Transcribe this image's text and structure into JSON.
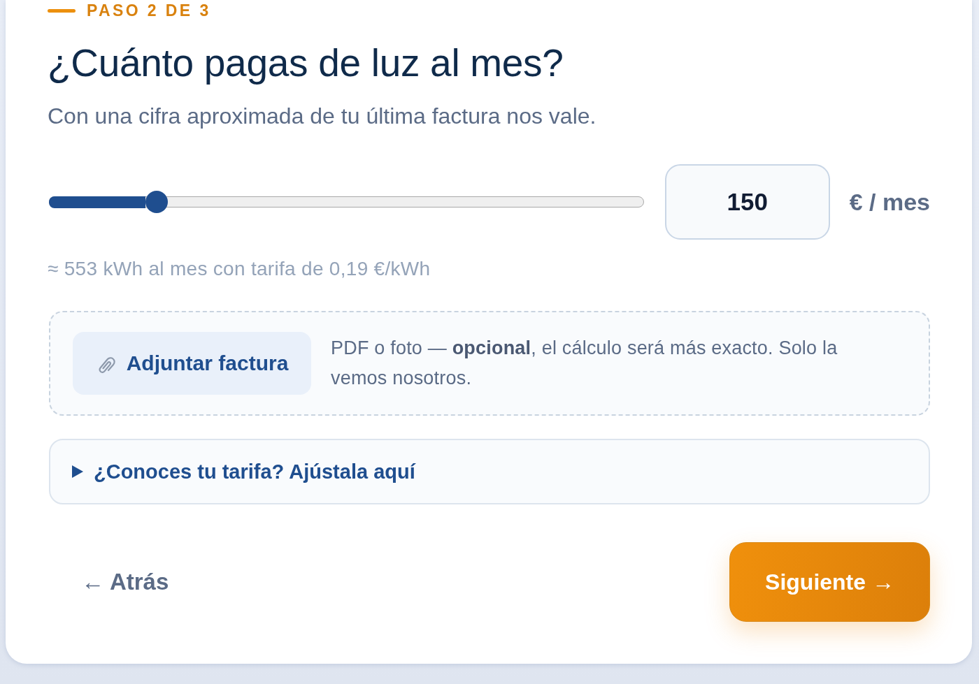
{
  "step": {
    "label": "PASO 2 DE 3"
  },
  "title": "¿Cuánto pagas de luz al mes?",
  "subtitle": "Con una cifra aproximada de tu última factura nos vale.",
  "bill_slider": {
    "level": 0.18
  },
  "amount_field": {
    "value": "150"
  },
  "unit": "€ / mes",
  "estimate": "≈ 553 kWh al mes con tarifa de 0,19 €/kWh",
  "attachment": {
    "button": "Adjuntar factura",
    "note": "PDF o foto — **opcional**, el cálculo será más exacto. Solo la vemos nosotros."
  },
  "tariff_toggle": {
    "label": "¿Conoces tu tarifa? Ajústala aquí",
    "expanded": false
  },
  "buttons": [
    {
      "label": "← Atrás",
      "kind": "back"
    },
    {
      "label": "Siguiente →",
      "kind": "primary"
    }
  ]
}
